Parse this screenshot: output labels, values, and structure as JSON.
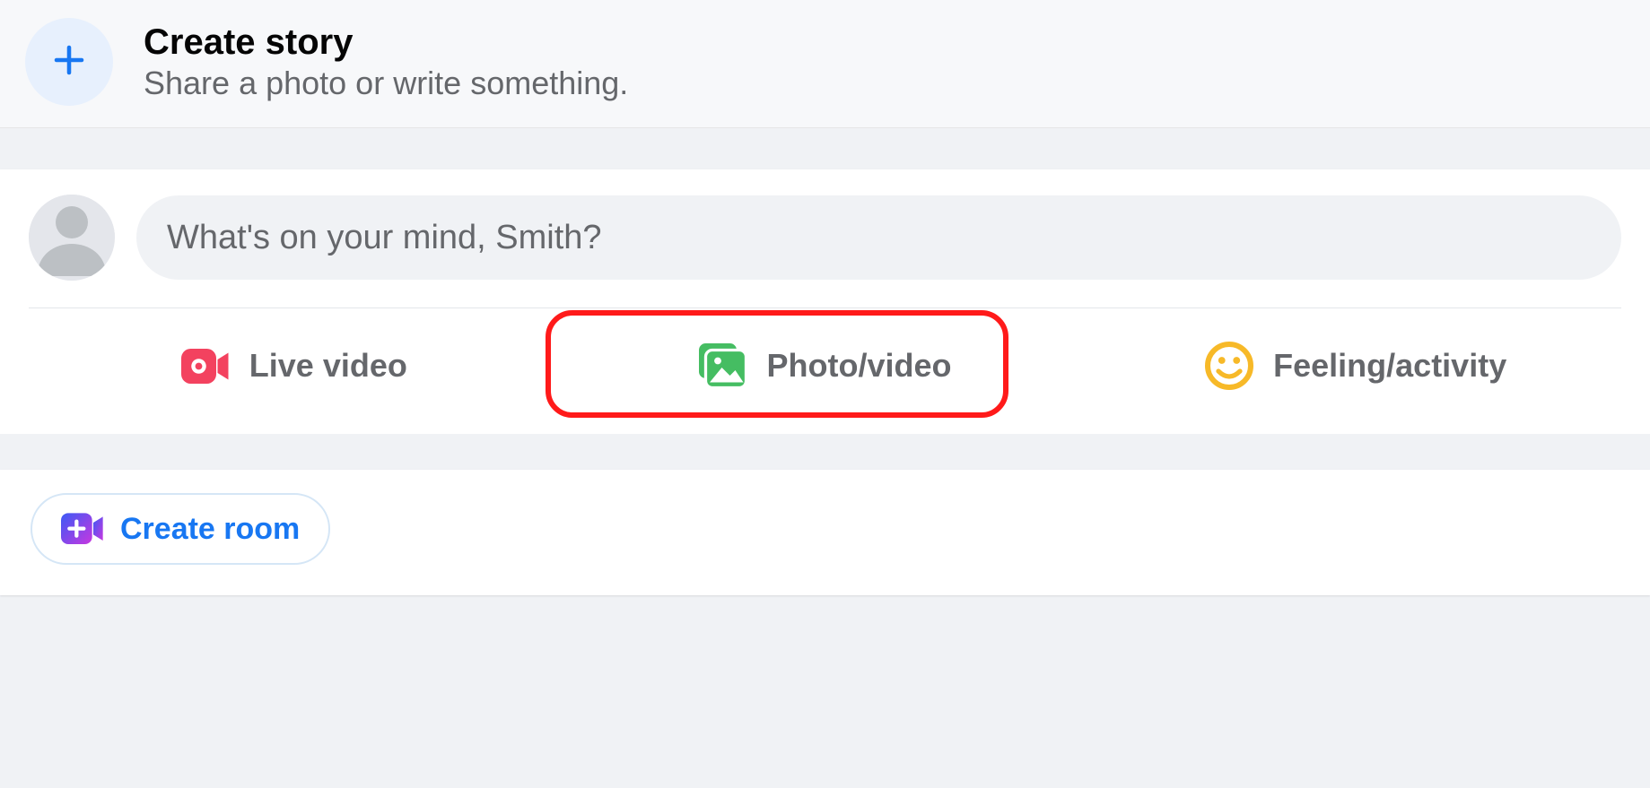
{
  "story": {
    "title": "Create story",
    "subtitle": "Share a photo or write something."
  },
  "composer": {
    "placeholder": "What's on your mind, Smith?",
    "actions": {
      "live_video": "Live video",
      "photo_video": "Photo/video",
      "feeling_activity": "Feeling/activity"
    }
  },
  "room": {
    "create_label": "Create room"
  }
}
